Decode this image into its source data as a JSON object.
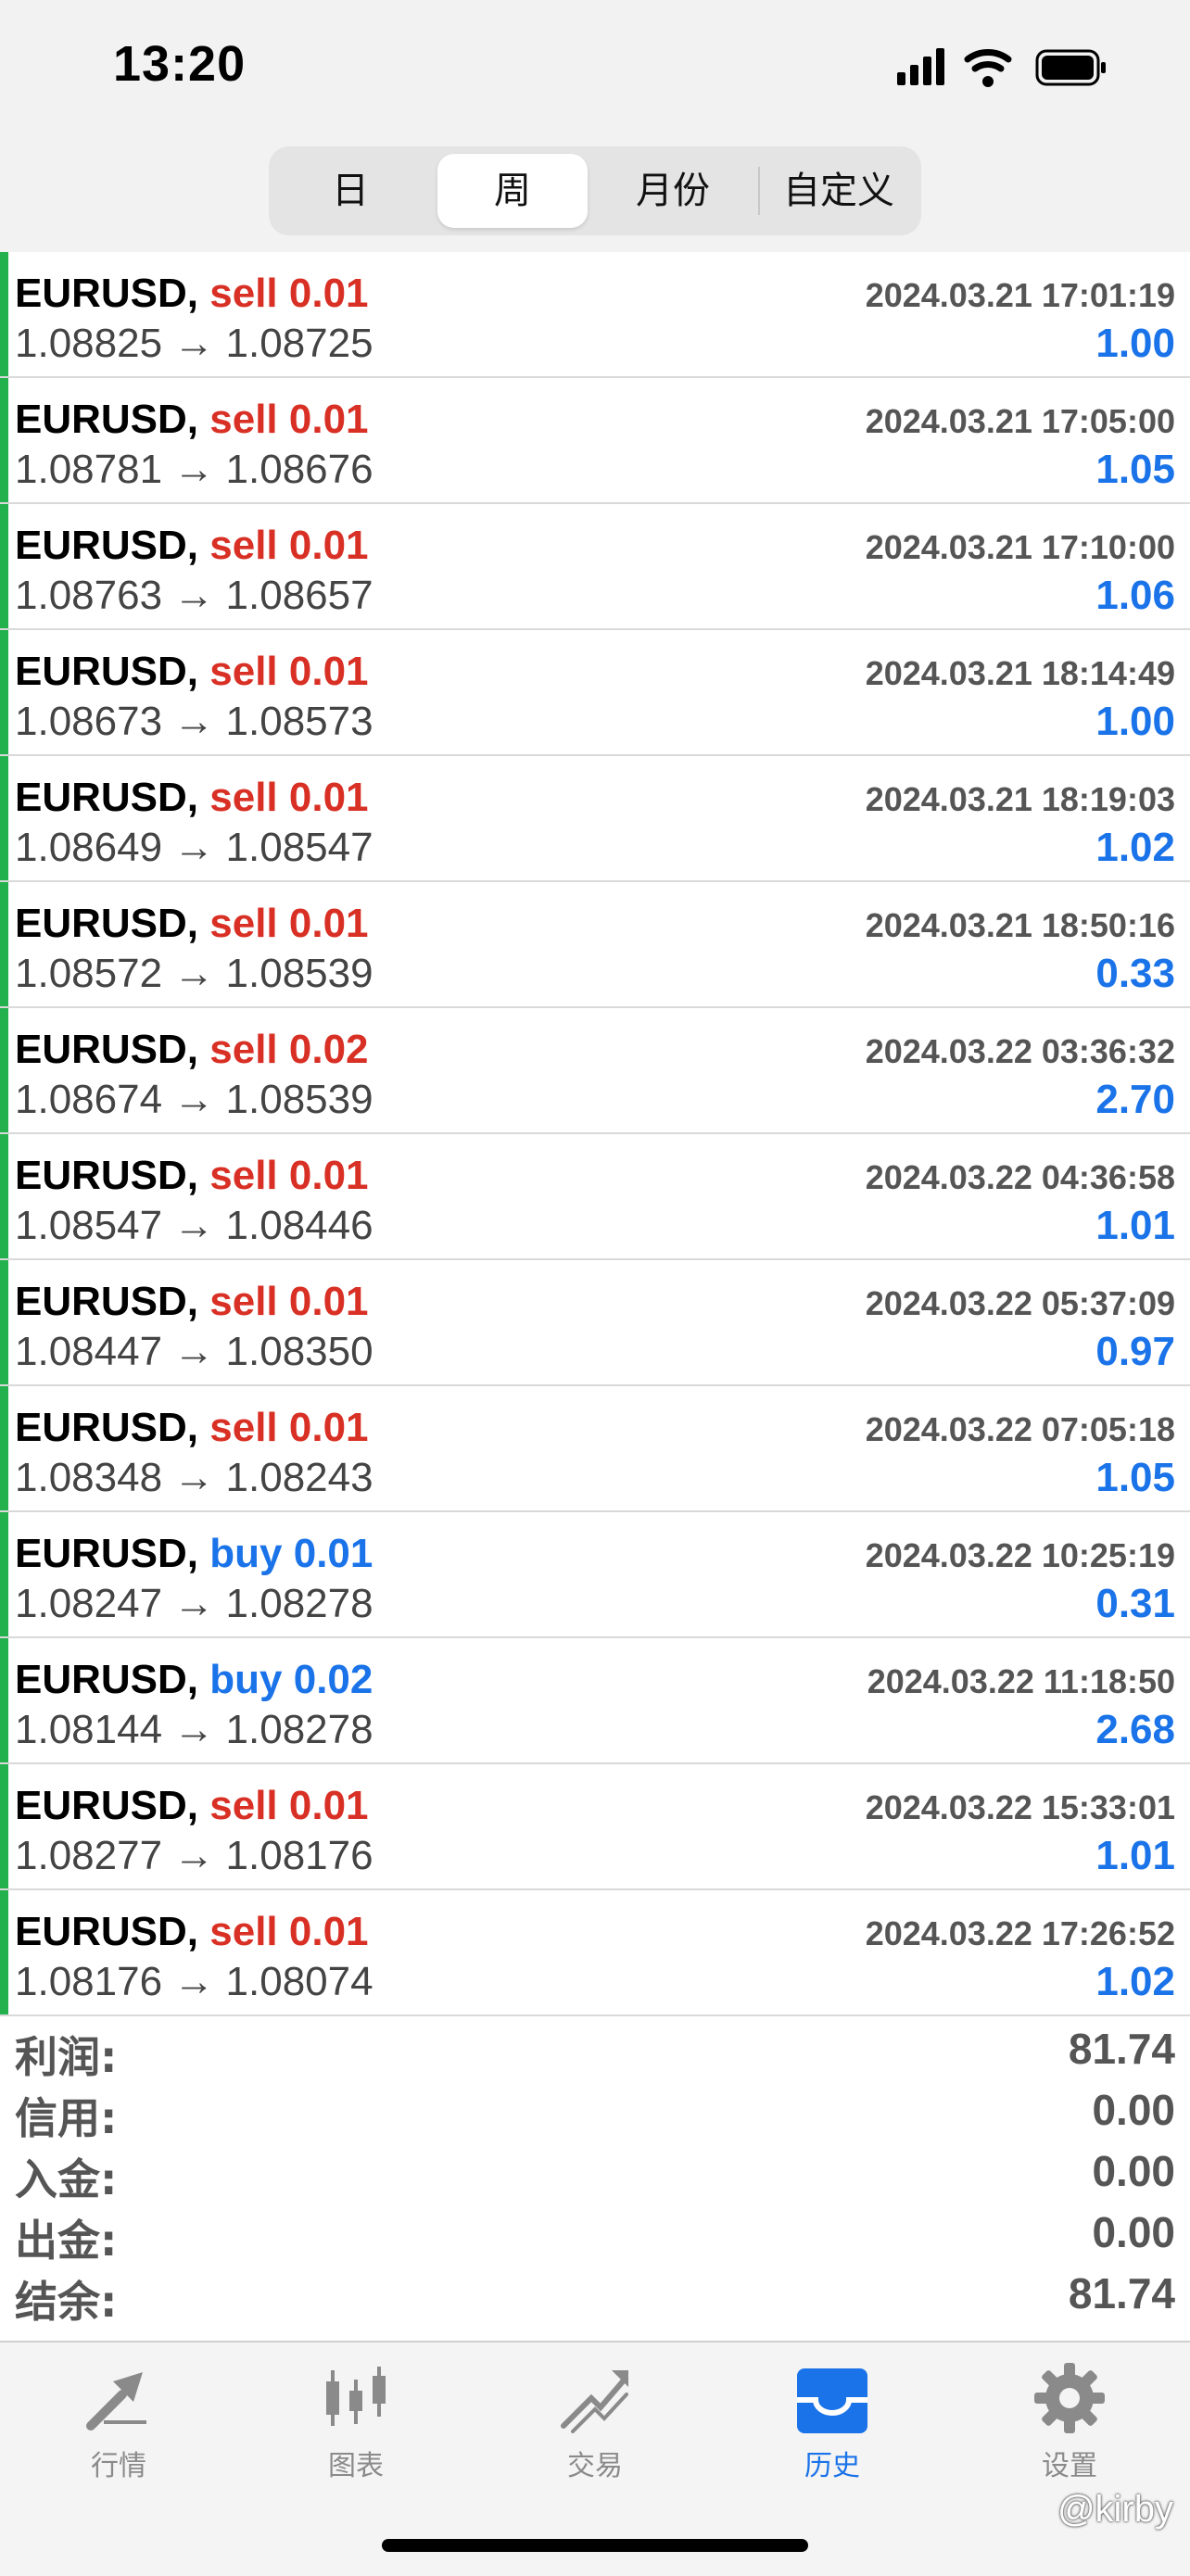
{
  "status_bar": {
    "time": "13:20"
  },
  "segmented": {
    "items": [
      "日",
      "周",
      "月份",
      "自定义"
    ],
    "selected": "周"
  },
  "trades": [
    {
      "symbol": "EURUSD,",
      "side": "sell",
      "volume": "0.01",
      "datetime": "2024.03.21 17:01:19",
      "open_price": "1.08825",
      "arrow": "→",
      "close_price": "1.08725",
      "profit": "1.00"
    },
    {
      "symbol": "EURUSD,",
      "side": "sell",
      "volume": "0.01",
      "datetime": "2024.03.21 17:05:00",
      "open_price": "1.08781",
      "arrow": "→",
      "close_price": "1.08676",
      "profit": "1.05"
    },
    {
      "symbol": "EURUSD,",
      "side": "sell",
      "volume": "0.01",
      "datetime": "2024.03.21 17:10:00",
      "open_price": "1.08763",
      "arrow": "→",
      "close_price": "1.08657",
      "profit": "1.06"
    },
    {
      "symbol": "EURUSD,",
      "side": "sell",
      "volume": "0.01",
      "datetime": "2024.03.21 18:14:49",
      "open_price": "1.08673",
      "arrow": "→",
      "close_price": "1.08573",
      "profit": "1.00"
    },
    {
      "symbol": "EURUSD,",
      "side": "sell",
      "volume": "0.01",
      "datetime": "2024.03.21 18:19:03",
      "open_price": "1.08649",
      "arrow": "→",
      "close_price": "1.08547",
      "profit": "1.02"
    },
    {
      "symbol": "EURUSD,",
      "side": "sell",
      "volume": "0.01",
      "datetime": "2024.03.21 18:50:16",
      "open_price": "1.08572",
      "arrow": "→",
      "close_price": "1.08539",
      "profit": "0.33"
    },
    {
      "symbol": "EURUSD,",
      "side": "sell",
      "volume": "0.02",
      "datetime": "2024.03.22 03:36:32",
      "open_price": "1.08674",
      "arrow": "→",
      "close_price": "1.08539",
      "profit": "2.70"
    },
    {
      "symbol": "EURUSD,",
      "side": "sell",
      "volume": "0.01",
      "datetime": "2024.03.22 04:36:58",
      "open_price": "1.08547",
      "arrow": "→",
      "close_price": "1.08446",
      "profit": "1.01"
    },
    {
      "symbol": "EURUSD,",
      "side": "sell",
      "volume": "0.01",
      "datetime": "2024.03.22 05:37:09",
      "open_price": "1.08447",
      "arrow": "→",
      "close_price": "1.08350",
      "profit": "0.97"
    },
    {
      "symbol": "EURUSD,",
      "side": "sell",
      "volume": "0.01",
      "datetime": "2024.03.22 07:05:18",
      "open_price": "1.08348",
      "arrow": "→",
      "close_price": "1.08243",
      "profit": "1.05"
    },
    {
      "symbol": "EURUSD,",
      "side": "buy",
      "volume": "0.01",
      "datetime": "2024.03.22 10:25:19",
      "open_price": "1.08247",
      "arrow": "→",
      "close_price": "1.08278",
      "profit": "0.31"
    },
    {
      "symbol": "EURUSD,",
      "side": "buy",
      "volume": "0.02",
      "datetime": "2024.03.22 11:18:50",
      "open_price": "1.08144",
      "arrow": "→",
      "close_price": "1.08278",
      "profit": "2.68"
    },
    {
      "symbol": "EURUSD,",
      "side": "sell",
      "volume": "0.01",
      "datetime": "2024.03.22 15:33:01",
      "open_price": "1.08277",
      "arrow": "→",
      "close_price": "1.08176",
      "profit": "1.01"
    },
    {
      "symbol": "EURUSD,",
      "side": "sell",
      "volume": "0.01",
      "datetime": "2024.03.22 17:26:52",
      "open_price": "1.08176",
      "arrow": "→",
      "close_price": "1.08074",
      "profit": "1.02"
    }
  ],
  "summary": [
    {
      "label": "利润:",
      "value": "81.74"
    },
    {
      "label": "信用:",
      "value": "0.00"
    },
    {
      "label": "入金:",
      "value": "0.00"
    },
    {
      "label": "出金:",
      "value": "0.00"
    },
    {
      "label": "结余:",
      "value": "81.74"
    }
  ],
  "tabbar": {
    "items": [
      {
        "label": "行情",
        "icon": "quotes-icon"
      },
      {
        "label": "图表",
        "icon": "chart-candles-icon"
      },
      {
        "label": "交易",
        "icon": "trade-icon"
      },
      {
        "label": "历史",
        "icon": "history-inbox-icon"
      },
      {
        "label": "设置",
        "icon": "gear-icon"
      }
    ],
    "active": "历史"
  },
  "watermark": "@kirby",
  "colors": {
    "sell": "#d93025",
    "buy": "#1a73e8",
    "profit": "#1a73e8",
    "row_indicator": "#22b14c",
    "active_tab": "#1a73e8"
  }
}
